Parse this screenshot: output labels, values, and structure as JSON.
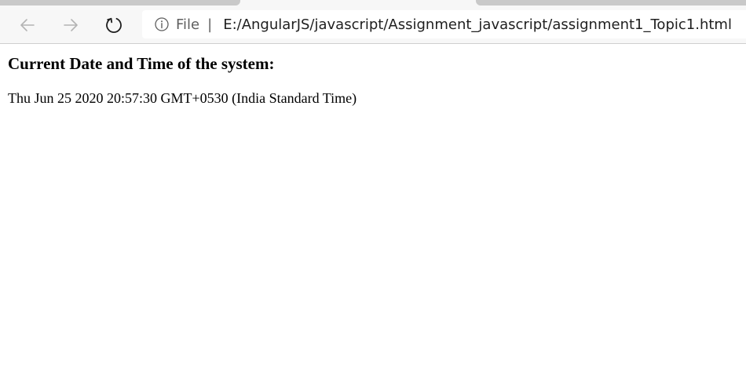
{
  "browser": {
    "address_scheme": "File",
    "address_separator": "|",
    "address_url": "E:/AngularJS/javascript/Assignment_javascript/assignment1_Topic1.html",
    "icons": {
      "back": "arrow-left-icon",
      "forward": "arrow-right-icon",
      "refresh": "refresh-icon",
      "info": "info-icon"
    }
  },
  "page": {
    "heading": "Current Date and Time of the system:",
    "datetime": "Thu Jun 25 2020 20:57:30 GMT+0530 (India Standard Time)"
  },
  "colors": {
    "chrome_background": "#f7f7f7",
    "tab_inactive": "#c9c9c9",
    "icon_disabled": "#b4b4b4",
    "icon_enabled": "#1f1f1f"
  }
}
